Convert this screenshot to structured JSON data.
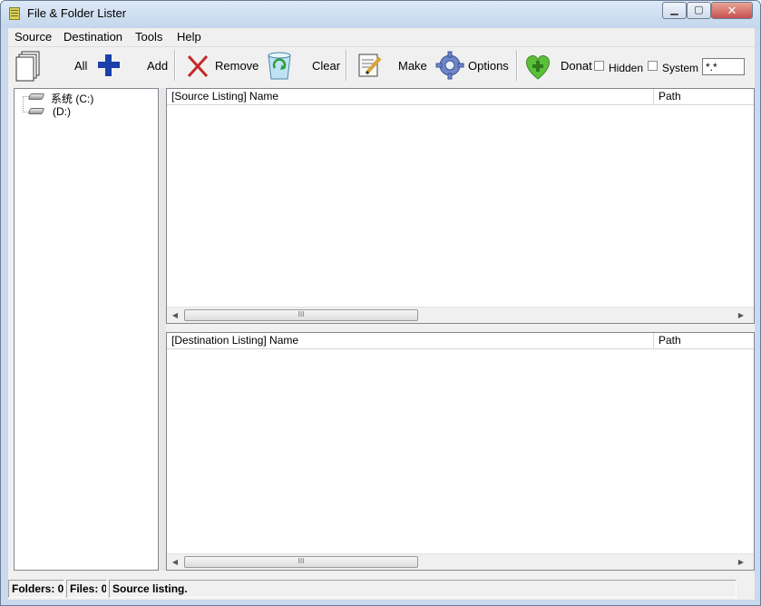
{
  "window": {
    "title": "File & Folder Lister",
    "minimize": "▁",
    "maximize": "▢",
    "close": "✕"
  },
  "menu": [
    "Source",
    "Destination",
    "Tools",
    "Help"
  ],
  "toolbar": {
    "all_label": "All",
    "add_label": "Add",
    "remove_label": "Remove",
    "clear_label": "Clear",
    "make_label": "Make",
    "options_label": "Options",
    "donate_label": "Donat",
    "hidden_label": "Hidden",
    "system_label": "System",
    "filter_value": "*.*",
    "icons": [
      "pages-icon",
      "plus-icon",
      "remove-x-icon",
      "recycle-bin-icon",
      "notepad-pencil-icon",
      "gear-icon",
      "heart-plus-icon"
    ]
  },
  "tree": {
    "items": [
      "系统 (C:)",
      "(D:)"
    ]
  },
  "source_list": {
    "columns": [
      "[Source Listing] Name",
      "Path"
    ],
    "scroll_thumb": "III"
  },
  "destination_list": {
    "columns": [
      "[Destination Listing] Name",
      "Path"
    ],
    "scroll_thumb": "III"
  },
  "status": {
    "folders": "Folders: 0",
    "files": "Files: 0",
    "message": "Source listing."
  },
  "colors": {
    "title_bar": "#c4d6ec",
    "close_button": "#c75050",
    "plus": "#1a3fa8",
    "remove_x": "#c62828",
    "heart": "#5cbf3a"
  }
}
